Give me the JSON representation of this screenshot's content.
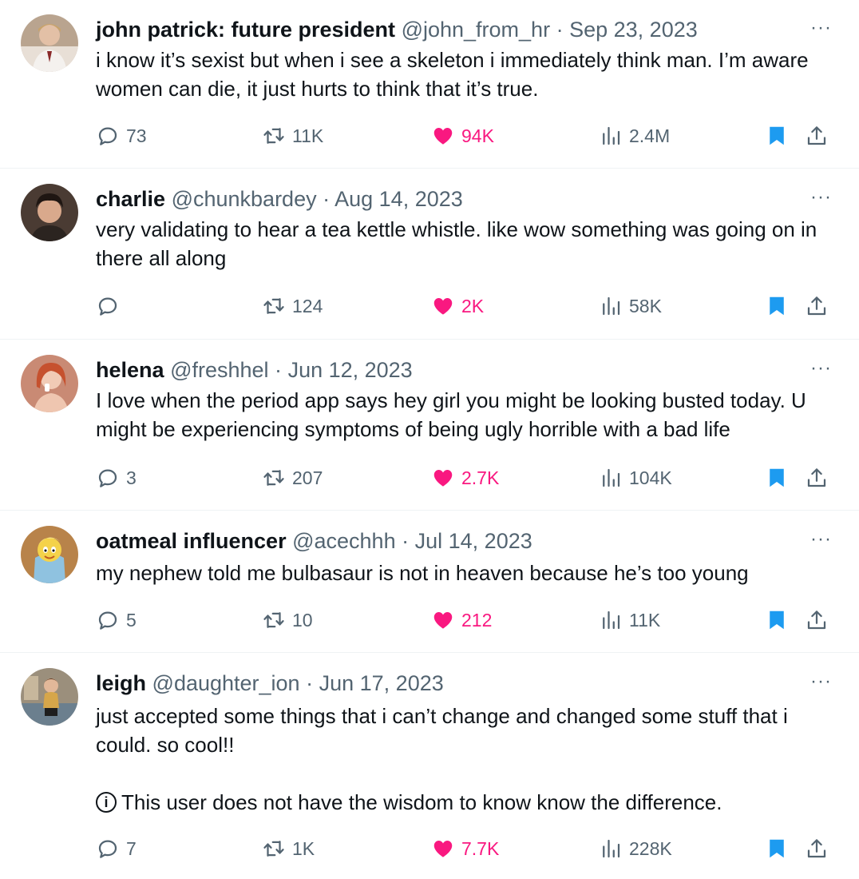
{
  "colors": {
    "text": "#0f1419",
    "secondary": "#536471",
    "like": "#f91880",
    "bookmark": "#1d9bf0",
    "divider": "#eff3f4"
  },
  "icons": {
    "reply": "speech-bubble-icon",
    "retweet": "retweet-arrows-icon",
    "like": "heart-filled-icon",
    "views": "bar-chart-icon",
    "bookmark": "bookmark-filled-icon",
    "share": "share-upload-icon",
    "more": "more-dots-icon"
  },
  "more_label": "···",
  "tweets": [
    {
      "name": "john patrick: future president",
      "handle": "@john_from_hr",
      "sep": "·",
      "date": "Sep 23, 2023",
      "text": "i know it’s sexist but when i see a skeleton i immediately think man. I’m aware women can die, it just hurts to think that it’s true.",
      "note": "",
      "replies": "73",
      "retweets": "11K",
      "likes": "94K",
      "views": "2.4M"
    },
    {
      "name": "charlie",
      "handle": "@chunkbardey",
      "sep": "·",
      "date": "Aug 14, 2023",
      "text": "very validating to hear a tea kettle whistle. like wow something was going on in there all along",
      "note": "",
      "replies": "",
      "retweets": "124",
      "likes": "2K",
      "views": "58K"
    },
    {
      "name": "helena",
      "handle": "@freshhel",
      "sep": "·",
      "date": "Jun 12, 2023",
      "text": "I love when the period app says hey girl you might be looking busted today. U might be experiencing symptoms of being ugly horrible with a bad life",
      "note": "",
      "replies": "3",
      "retweets": "207",
      "likes": "2.7K",
      "views": "104K"
    },
    {
      "name": "oatmeal influencer",
      "handle": "@acechhh",
      "sep": "·",
      "date": "Jul 14, 2023",
      "text": "my nephew told me bulbasaur is not in heaven because he’s too young",
      "note": "",
      "replies": "5",
      "retweets": "10",
      "likes": "212",
      "views": "11K"
    },
    {
      "name": "leigh",
      "handle": "@daughter_ion",
      "sep": "·",
      "date": "Jun 17, 2023",
      "text": "just accepted some things that i can’t change and changed some stuff that i could. so cool!!",
      "note_icon": "i",
      "note": "This user does not have the wisdom to know know the difference.",
      "replies": "7",
      "retweets": "1K",
      "likes": "7.7K",
      "views": "228K"
    }
  ]
}
